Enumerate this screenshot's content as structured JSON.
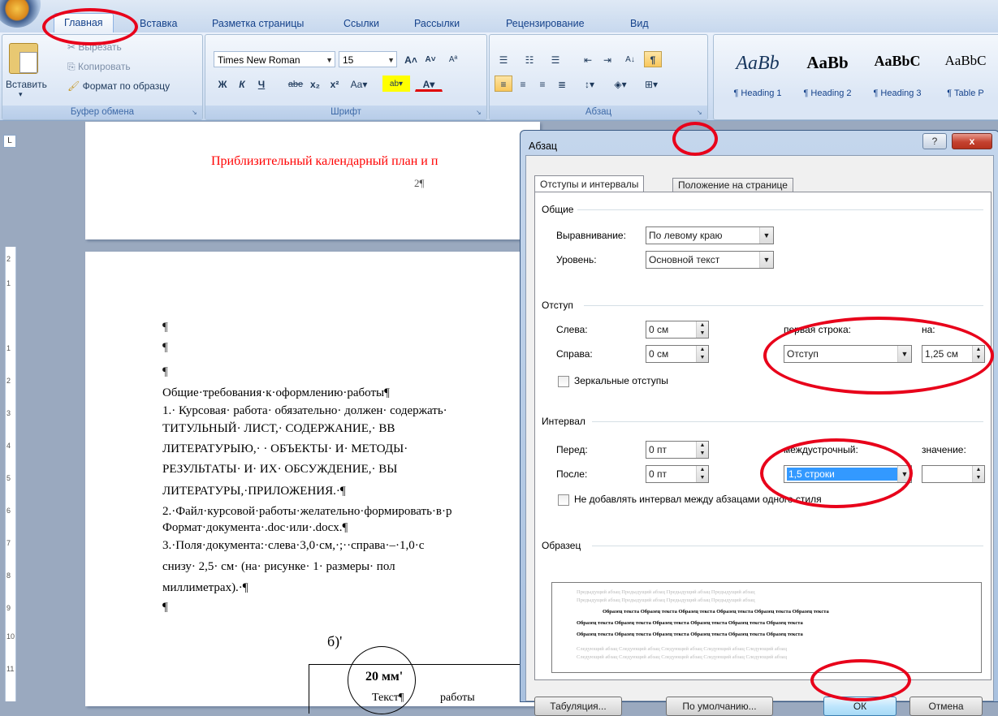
{
  "ribbon": {
    "tabs": [
      "Главная",
      "Вставка",
      "Разметка страницы",
      "Ссылки",
      "Рассылки",
      "Рецензирование",
      "Вид"
    ],
    "clipboard": {
      "paste": "Вставить",
      "cut": "Вырезать",
      "copy": "Копировать",
      "format_painter": "Формат по образцу",
      "label": "Буфер обмена"
    },
    "font": {
      "family": "Times New Roman",
      "size": "15",
      "label": "Шрифт"
    },
    "paragraph": {
      "label": "Абзац"
    },
    "styles": [
      {
        "sample": "AaBb",
        "name": "¶ Heading 1"
      },
      {
        "sample": "AaBb",
        "name": "¶ Heading 2"
      },
      {
        "sample": "AaBbC",
        "name": "¶ Heading 3"
      },
      {
        "sample": "AaBbC",
        "name": "¶ Table P"
      }
    ]
  },
  "document": {
    "page1_red_line": "Приблизительный календарный план и п",
    "page1_page_number": "2¶",
    "pilcrow": "¶",
    "heading": "Общие·требования·к·оформлению·работы¶",
    "lines": [
      "1.· Курсовая· работа· обязательно· должен· содержать·",
      "ТИТУЛЬНЫЙ· ЛИСТ,· СОДЕРЖАНИЕ,· ВВ",
      "ЛИТЕРАТУРЫЮ,· · ОБЪЕКТЫ· И· МЕТОДЫ·",
      "РЕЗУЛЬТАТЫ· И· ИХ· ОБСУЖДЕНИЕ,· ВЫ",
      "ЛИТЕРАТУРЫ,·ПРИЛОЖЕНИЯ.·¶",
      "2.·Файл·курсовой·работы·желательно·формировать·в·р",
      "Формат·документа·.doc·или·.docx.¶",
      "3.·Поля·документа:·слева·3,0·см,·;··справа·–·1,0·с",
      "снизу· 2,5· см· (на· рисунке· 1· размеры· пол",
      "миллиметрах).·¶",
      "¶"
    ],
    "figure_label": "б)'",
    "figure_mm": "20 мм'",
    "figure_text1": "Текст¶",
    "figure_text2": "работы"
  },
  "dialog": {
    "title": "Абзац",
    "help": "?",
    "close": "x",
    "tabs": [
      "Отступы и интервалы",
      "Положение на странице"
    ],
    "general": {
      "title": "Общие",
      "alignment_label": "Выравнивание:",
      "alignment_value": "По левому краю",
      "level_label": "Уровень:",
      "level_value": "Основной текст"
    },
    "indent": {
      "title": "Отступ",
      "left_label": "Слева:",
      "left_value": "0 см",
      "right_label": "Справа:",
      "right_value": "0 см",
      "first_line_label": "первая строка:",
      "first_line_value": "Отступ",
      "by_label": "на:",
      "by_value": "1,25 см",
      "mirror_label": "Зеркальные отступы"
    },
    "spacing": {
      "title": "Интервал",
      "before_label": "Перед:",
      "before_value": "0 пт",
      "after_label": "После:",
      "after_value": "0 пт",
      "line_spacing_label": "междустрочный:",
      "line_spacing_value": "1,5 строки",
      "at_label": "значение:",
      "at_value": "",
      "no_space_label": "Не добавлять интервал между абзацами одного стиля"
    },
    "preview": {
      "title": "Образец",
      "prev": "Предыдущий абзац Предыдущий абзац Предыдущий абзац Предыдущий абзац",
      "sample": "Образец текста Образец текста Образец текста Образец текста Образец текста Образец текста",
      "next": "Следующий абзац Следующий абзац Следующий абзац Следующий абзац Следующий абзац"
    },
    "buttons": {
      "tabs": "Табуляция...",
      "default": "По умолчанию...",
      "ok": "ОК",
      "cancel": "Отмена"
    }
  },
  "colors": {
    "annotation": "#e8001a",
    "ribbon_text": "#15428b",
    "selection": "#3399ff"
  }
}
